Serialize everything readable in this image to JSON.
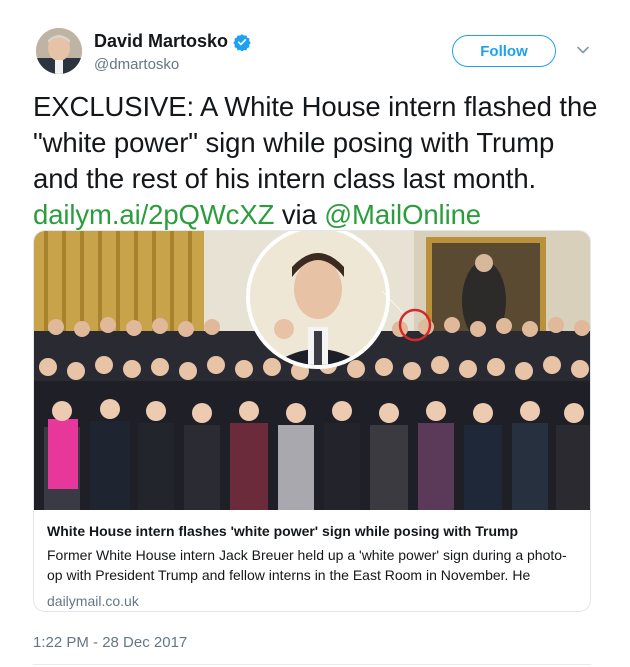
{
  "author": {
    "name": "David Martosko",
    "handle": "@dmartosko",
    "verified": true
  },
  "follow_label": "Follow",
  "tweet": {
    "text": "EXCLUSIVE: A White House intern flashed the \"white power\" sign while posing with Trump and the rest of his intern class last month.",
    "link": "dailym.ai/2pQWcXZ",
    "via": "via",
    "mention": "@MailOnline"
  },
  "card": {
    "title": "White House intern flashes 'white power' sign while posing with Trump",
    "description": "Former White House intern Jack Breuer held up a 'white power' sign during a photo-op with President Trump and fellow interns in the East Room in November. He",
    "domain": "dailymail.co.uk"
  },
  "timestamp": "1:22 PM - 28 Dec 2017",
  "colors": {
    "accent": "#1da1f2",
    "link_green": "#2b9d3d",
    "muted": "#657786"
  }
}
